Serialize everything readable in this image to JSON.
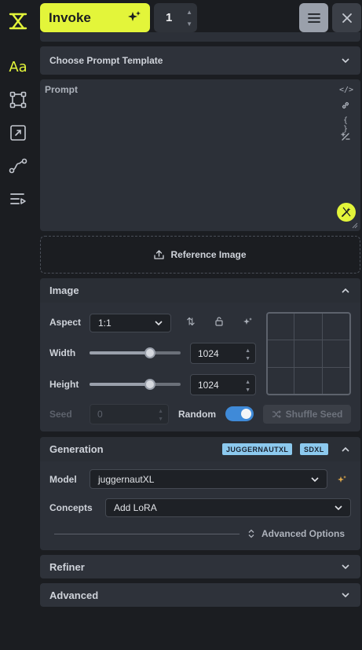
{
  "toolbar": {
    "invoke_label": "Invoke",
    "iterations": "1"
  },
  "sidebar": {
    "items": [
      {
        "name": "logo",
        "icon": "invoke-logo-icon"
      },
      {
        "name": "text-to-image",
        "icon": "typography-icon",
        "label": "Aa"
      },
      {
        "name": "workflows",
        "icon": "bounding-box-icon"
      },
      {
        "name": "upscaling",
        "icon": "resize-icon"
      },
      {
        "name": "models",
        "icon": "path-icon"
      },
      {
        "name": "queue",
        "icon": "queue-list-icon"
      }
    ]
  },
  "prompt_template": {
    "placeholder": "Choose Prompt Template"
  },
  "prompt": {
    "label": "Prompt",
    "tools": [
      "</>",
      "link",
      "{ }",
      "+/-"
    ]
  },
  "reference_image": {
    "label": "Reference Image"
  },
  "image_section": {
    "title": "Image",
    "aspect_label": "Aspect",
    "aspect_value": "1:1",
    "width_label": "Width",
    "width_value": "1024",
    "width_slider_fraction": 0.66,
    "height_label": "Height",
    "height_value": "1024",
    "height_slider_fraction": 0.66,
    "seed_label": "Seed",
    "seed_value": "0",
    "random_label": "Random",
    "random_on": true,
    "shuffle_label": "Shuffle Seed"
  },
  "generation_section": {
    "title": "Generation",
    "badges": [
      "JUGGERNAUTXL",
      "SDXL"
    ],
    "model_label": "Model",
    "model_value": "juggernautXL",
    "concepts_label": "Concepts",
    "concepts_value": "Add LoRA",
    "advanced_options_label": "Advanced Options"
  },
  "refiner_section": {
    "title": "Refiner"
  },
  "advanced_section": {
    "title": "Advanced"
  },
  "colors": {
    "accent": "#e3f53a",
    "badge": "#8cc9ee",
    "toggle": "#3f8ad8",
    "background": "#1b1d21",
    "panel": "#2c3038"
  }
}
